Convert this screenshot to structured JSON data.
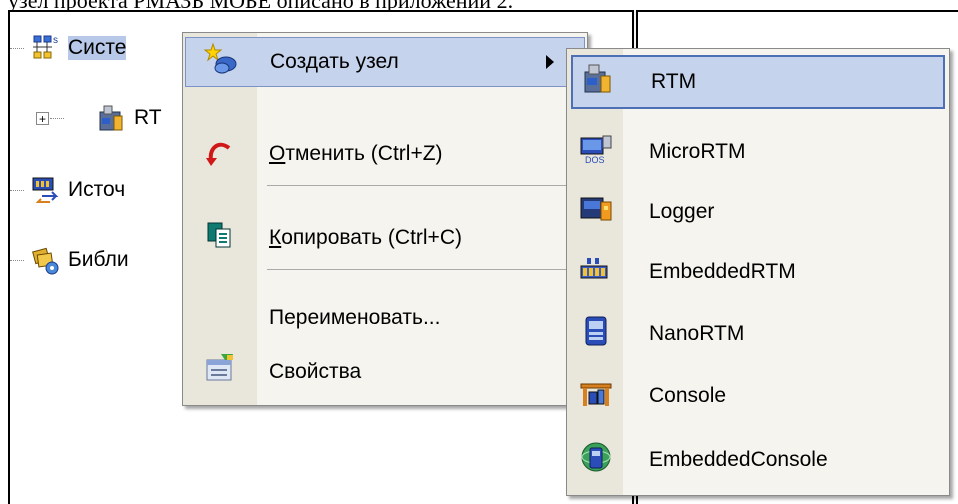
{
  "doc_caption": "узел проекта РМАЗБ МОБЕ описано в приложении 2.",
  "tree": {
    "nodes": [
      {
        "label": "Систе",
        "icon": "system-network-icon"
      },
      {
        "label": "RT",
        "icon": "rtm-node-icon"
      },
      {
        "label": "Источ",
        "icon": "sources-icon"
      },
      {
        "label": "Библи",
        "icon": "library-icon"
      }
    ]
  },
  "context_menu": {
    "items": [
      {
        "label": "Создать узел",
        "icon": "create-node-icon"
      },
      {
        "label_u": "О",
        "label_rest": "тменить (Ctrl+Z)",
        "icon": "undo-icon"
      },
      {
        "label_u": "К",
        "label_rest": "опировать (Ctrl+C)",
        "icon": "copy-icon"
      },
      {
        "label": "Переименовать...",
        "icon": ""
      },
      {
        "label": "Свойства",
        "icon": "properties-icon"
      }
    ]
  },
  "submenu": {
    "items": [
      {
        "label": "RTM",
        "icon": "rtm-icon"
      },
      {
        "label": "MicroRTM",
        "icon": "micrortm-icon"
      },
      {
        "label": "Logger",
        "icon": "logger-icon"
      },
      {
        "label": "EmbeddedRTM",
        "icon": "embeddedrtm-icon"
      },
      {
        "label": "NanoRTM",
        "icon": "nanortm-icon"
      },
      {
        "label": "Console",
        "icon": "console-icon"
      },
      {
        "label": "EmbeddedConsole",
        "icon": "embeddedconsole-icon"
      }
    ]
  },
  "colors": {
    "highlight": "#c6d3ec",
    "highlight_border": "#4c6fb5",
    "menu_bg": "#f5f4ee",
    "icon_strip": "#e9e7dc"
  }
}
